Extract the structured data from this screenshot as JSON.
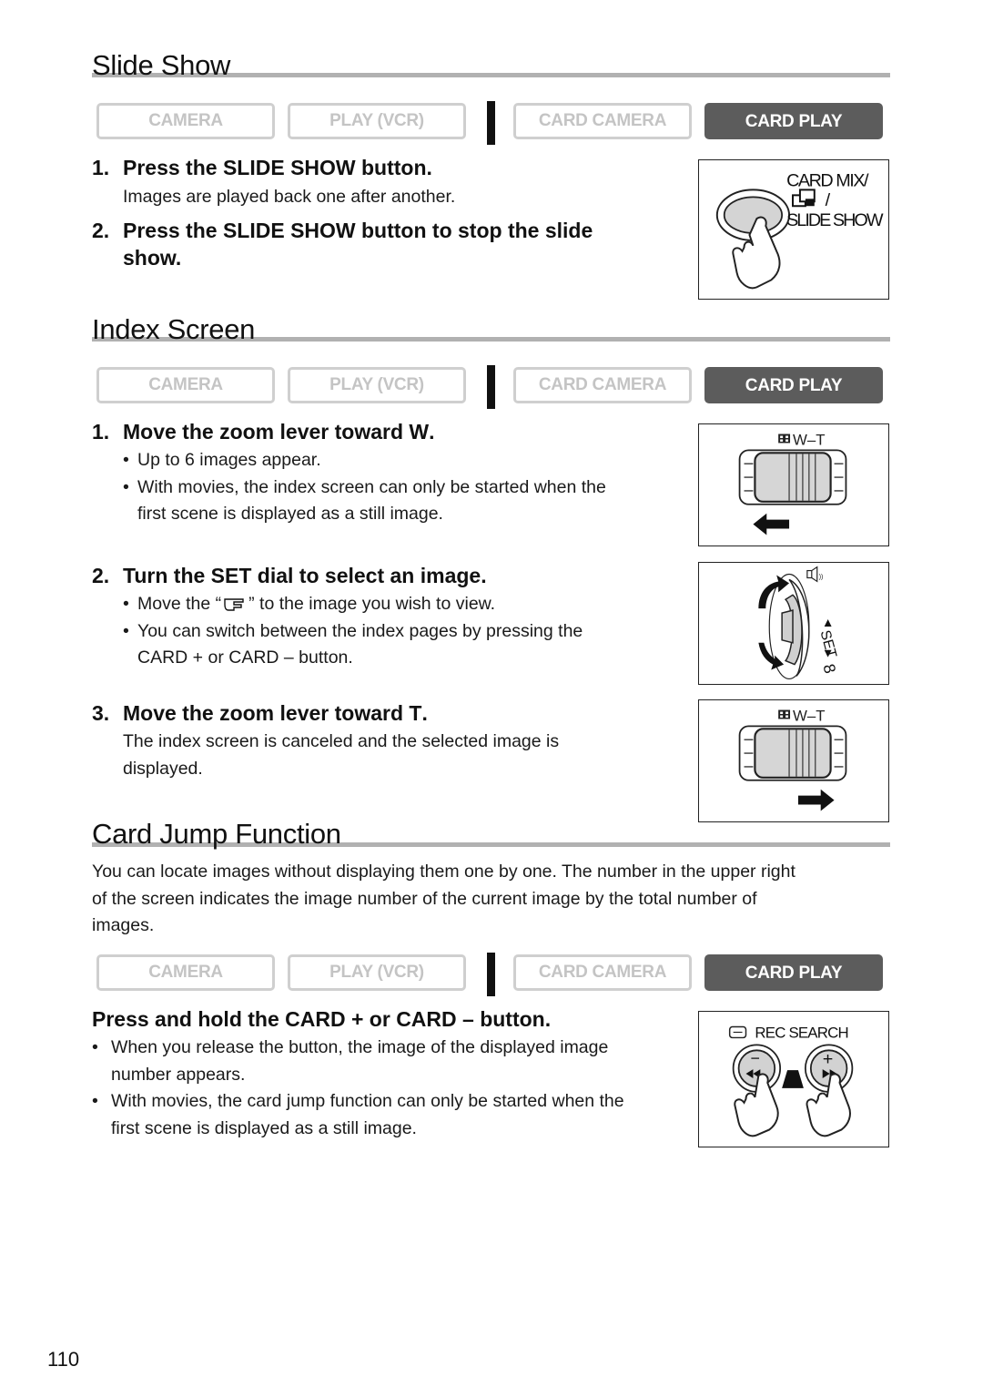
{
  "mode_bar": {
    "modes": [
      {
        "label": "CAMERA",
        "active": false
      },
      {
        "label": "PLAY (VCR)",
        "active": false
      },
      {
        "label": "CARD CAMERA",
        "active": false
      },
      {
        "label": "CARD PLAY",
        "active": true
      }
    ],
    "active_color": "#5c5c5c",
    "inactive_color": "#c4c4c4"
  },
  "slide_show": {
    "title": "Slide Show",
    "steps": [
      {
        "num": "1.",
        "text": "Press the SLIDE SHOW button.",
        "body": "Images are played back one after another."
      },
      {
        "num": "2.",
        "text_line1": "Press the SLIDE SHOW button to stop the slide",
        "text_line2": "show."
      }
    ],
    "illustration": {
      "label_line1": "CARD MIX/",
      "label_line2": "/",
      "label_line3": "SLIDE SHOW",
      "icon": "card-mix-icon"
    }
  },
  "index_screen": {
    "title": "Index Screen",
    "steps": [
      {
        "num": "1.",
        "text": "Move the zoom lever toward ",
        "key": "W",
        "end": ".",
        "bullets": [
          "Up to 6 images appear.",
          "With movies, the index screen can only be started when the",
          "first scene is displayed as a still image."
        ],
        "illustration": {
          "label": "W–T",
          "arrow": "left-arrow-icon"
        }
      },
      {
        "num": "2.",
        "text": "Turn the SET dial to select an image.",
        "bullets": [
          {
            "before": "Move the “",
            "after": "” to the image you wish to view."
          },
          "You can switch between the index pages by pressing the",
          "CARD + or CARD – button."
        ],
        "illustration": {
          "label": "SET",
          "icon": "set-dial-icon"
        }
      },
      {
        "num": "3.",
        "text": "Move the zoom lever toward ",
        "key": "T",
        "end": ".",
        "body_line1": "The index screen is canceled and the selected image is",
        "body_line2": "displayed.",
        "illustration": {
          "label": "W–T",
          "arrow": "right-arrow-icon"
        }
      }
    ]
  },
  "card_jump": {
    "title": "Card Jump Function",
    "intro_line1": "You can locate images without displaying them one by one. The number in the upper right",
    "intro_line2": "of the screen indicates the image number of the current image by the total number of",
    "intro_line3": "images.",
    "step_text": "Press and hold the CARD + or CARD – button.",
    "bullets": [
      "When you release the button, the image of the displayed image",
      "number appears.",
      "With movies, the card jump function can only be started when the",
      "first scene is displayed as a still image."
    ],
    "illustration": {
      "label": "REC SEARCH",
      "minus": "−",
      "plus": "+"
    }
  },
  "page_number": "110"
}
